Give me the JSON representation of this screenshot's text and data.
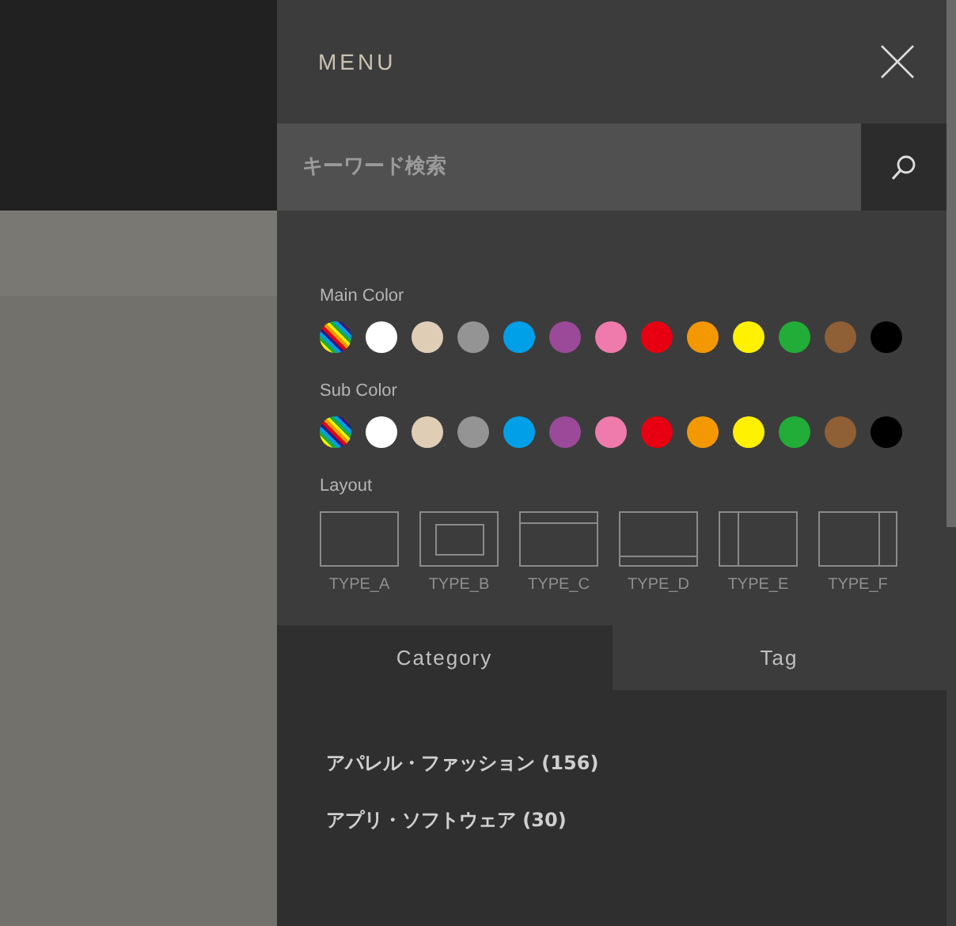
{
  "menu": {
    "title": "MENU"
  },
  "search": {
    "placeholder": "キーワード検索"
  },
  "main_color": {
    "label": "Main Color",
    "swatches": [
      {
        "kind": "rainbow"
      },
      {
        "kind": "solid",
        "color": "#ffffff"
      },
      {
        "kind": "solid",
        "color": "#dfcdb6"
      },
      {
        "kind": "solid",
        "color": "#949494"
      },
      {
        "kind": "solid",
        "color": "#00a0e9"
      },
      {
        "kind": "solid",
        "color": "#9a4a98"
      },
      {
        "kind": "solid",
        "color": "#ee7bac"
      },
      {
        "kind": "solid",
        "color": "#e60012"
      },
      {
        "kind": "solid",
        "color": "#f39800"
      },
      {
        "kind": "solid",
        "color": "#fff100"
      },
      {
        "kind": "solid",
        "color": "#22ac38"
      },
      {
        "kind": "solid",
        "color": "#8f5f35"
      },
      {
        "kind": "solid",
        "color": "#000000"
      }
    ]
  },
  "sub_color": {
    "label": "Sub Color",
    "swatches": [
      {
        "kind": "rainbow"
      },
      {
        "kind": "solid",
        "color": "#ffffff"
      },
      {
        "kind": "solid",
        "color": "#dfcdb6"
      },
      {
        "kind": "solid",
        "color": "#949494"
      },
      {
        "kind": "solid",
        "color": "#00a0e9"
      },
      {
        "kind": "solid",
        "color": "#9a4a98"
      },
      {
        "kind": "solid",
        "color": "#ee7bac"
      },
      {
        "kind": "solid",
        "color": "#e60012"
      },
      {
        "kind": "solid",
        "color": "#f39800"
      },
      {
        "kind": "solid",
        "color": "#fff100"
      },
      {
        "kind": "solid",
        "color": "#22ac38"
      },
      {
        "kind": "solid",
        "color": "#8f5f35"
      },
      {
        "kind": "solid",
        "color": "#000000"
      }
    ]
  },
  "layout": {
    "label": "Layout",
    "types": [
      {
        "kind": "plain",
        "label": "TYPE_A"
      },
      {
        "kind": "inset",
        "label": "TYPE_B"
      },
      {
        "kind": "header",
        "label": "TYPE_C"
      },
      {
        "kind": "footer",
        "label": "TYPE_D"
      },
      {
        "kind": "left",
        "label": "TYPE_E"
      },
      {
        "kind": "right",
        "label": "TYPE_F"
      }
    ]
  },
  "tabs": [
    {
      "label": "Category",
      "selected": true
    },
    {
      "label": "Tag",
      "selected": false
    }
  ],
  "categories": [
    "アパレル・ファッション (156)",
    "アプリ・ソフトウェア (30)"
  ]
}
